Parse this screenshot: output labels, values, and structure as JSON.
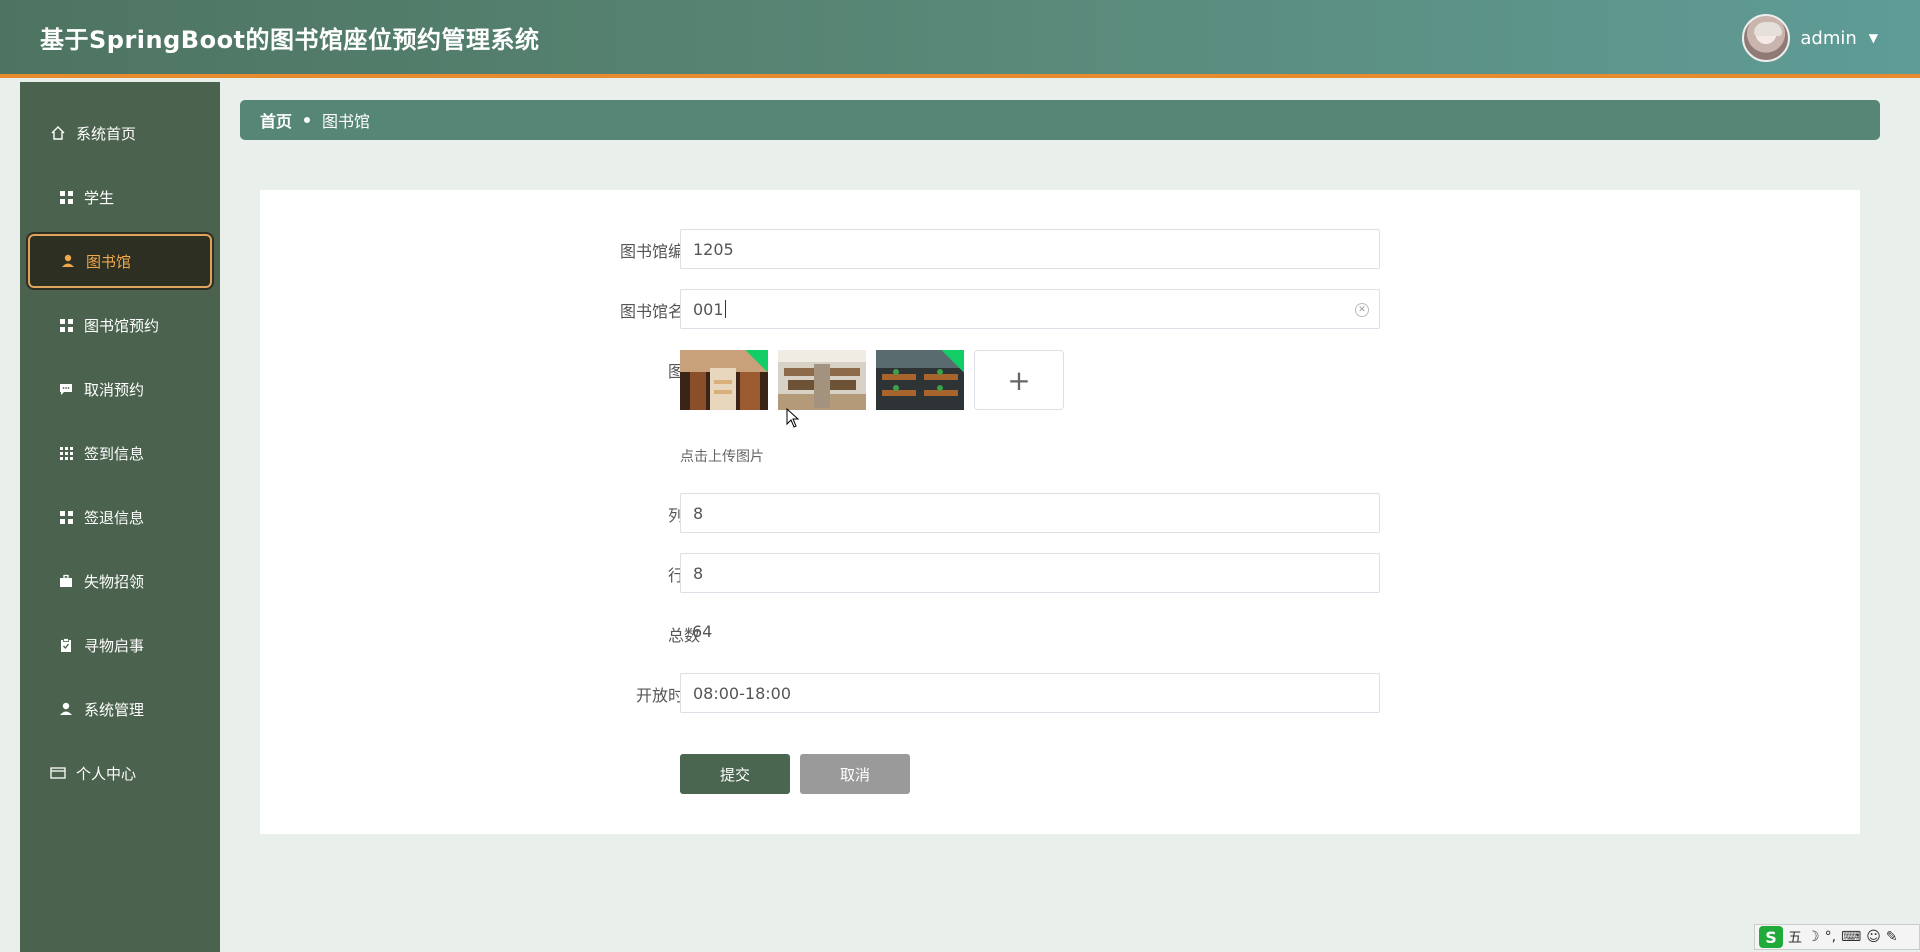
{
  "header": {
    "app_title": "基于SpringBoot的图书馆座位预约管理系统",
    "user_name": "admin"
  },
  "sidebar": {
    "items": [
      {
        "label": "系统首页",
        "icon": "home-icon"
      },
      {
        "label": "学生",
        "icon": "grid-icon"
      },
      {
        "label": "图书馆",
        "icon": "user-icon",
        "active": true
      },
      {
        "label": "图书馆预约",
        "icon": "grid-icon"
      },
      {
        "label": "取消预约",
        "icon": "chat-icon"
      },
      {
        "label": "签到信息",
        "icon": "grid9-icon"
      },
      {
        "label": "签退信息",
        "icon": "grid-icon"
      },
      {
        "label": "失物招领",
        "icon": "briefcase-icon"
      },
      {
        "label": "寻物启事",
        "icon": "clipboard-icon"
      },
      {
        "label": "系统管理",
        "icon": "user-icon"
      },
      {
        "label": "个人中心",
        "icon": "card-icon"
      }
    ]
  },
  "breadcrumb": {
    "home": "首页",
    "current": "图书馆"
  },
  "form": {
    "library_code": {
      "label": "图书馆编号",
      "value": "1205"
    },
    "library_name": {
      "label": "图书馆名称",
      "value": "001"
    },
    "images": {
      "label": "图片",
      "tip": "点击上传图片",
      "add_symbol": "+"
    },
    "columns": {
      "label": "列数",
      "value": "8"
    },
    "rows": {
      "label": "行数",
      "value": "8"
    },
    "total": {
      "label": "总数",
      "value": "64"
    },
    "open_time": {
      "label": "开放时间",
      "value": "08:00-18:00"
    },
    "submit_label": "提交",
    "cancel_label": "取消"
  },
  "ime": {
    "label": "五"
  },
  "colors": {
    "header_start": "#4e7461",
    "header_end": "#5f9c97",
    "accent": "#e88a2e",
    "sidebar": "#4b634e",
    "submit": "#4a6550",
    "upload_success": "#13ce66"
  }
}
